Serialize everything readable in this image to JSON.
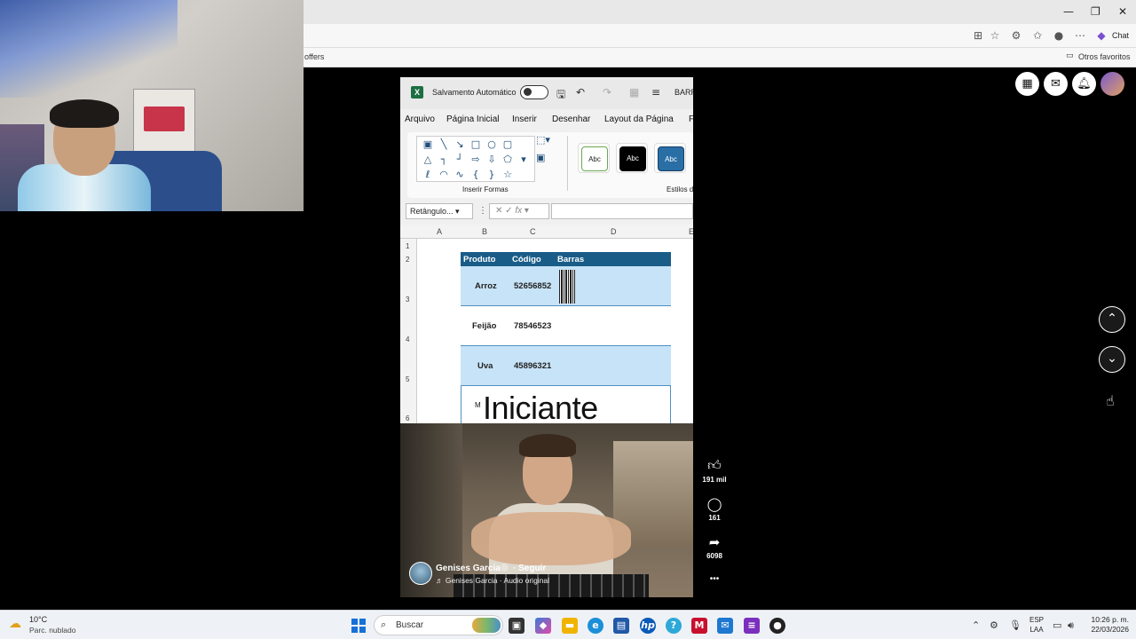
{
  "browser": {
    "chat_label": "Chat",
    "bookmark_left": "offers",
    "bookmark_right": "Otros favoritos",
    "window_controls": [
      "—",
      "❐",
      "✕"
    ]
  },
  "excel": {
    "autosave_label": "Salvamento Automático",
    "file_name": "BARR",
    "menu": [
      "Arquivo",
      "Página Inicial",
      "Inserir",
      "Desenhar",
      "Layout da Página",
      "F"
    ],
    "ribbon_group_shapes": "Inserir Formas",
    "ribbon_group_styles": "Estilos d",
    "style_box_label": "Abc",
    "namebox_value": "Retângulo...",
    "fx_label": "fx",
    "columns": [
      "A",
      "B",
      "C",
      "D",
      "E"
    ],
    "rows": [
      "1",
      "2",
      "3",
      "4",
      "5",
      "6"
    ],
    "table_headers": [
      "Produto",
      "Código",
      "Barras"
    ],
    "products": [
      {
        "name": "Arroz",
        "code": "52656852"
      },
      {
        "name": "Feijão",
        "code": "78546523"
      },
      {
        "name": "Uva",
        "code": "45896321"
      }
    ],
    "overlay_small": "M",
    "overlay_text": "Iniciante"
  },
  "reel": {
    "author": "Genises Garcia",
    "follow": "· Seguir",
    "audio": "♬ Genises Garcia · Audio original",
    "likes": "191 mil",
    "comments": "161",
    "shares": "6098",
    "more": "•••"
  },
  "taskbar": {
    "temperature": "10°C",
    "weather": "Parc. nublado",
    "search_placeholder": "Buscar",
    "lang_line1": "ESP",
    "lang_line2": "LAA",
    "time": "10:26 p. m.",
    "date": "22/03/2026"
  }
}
